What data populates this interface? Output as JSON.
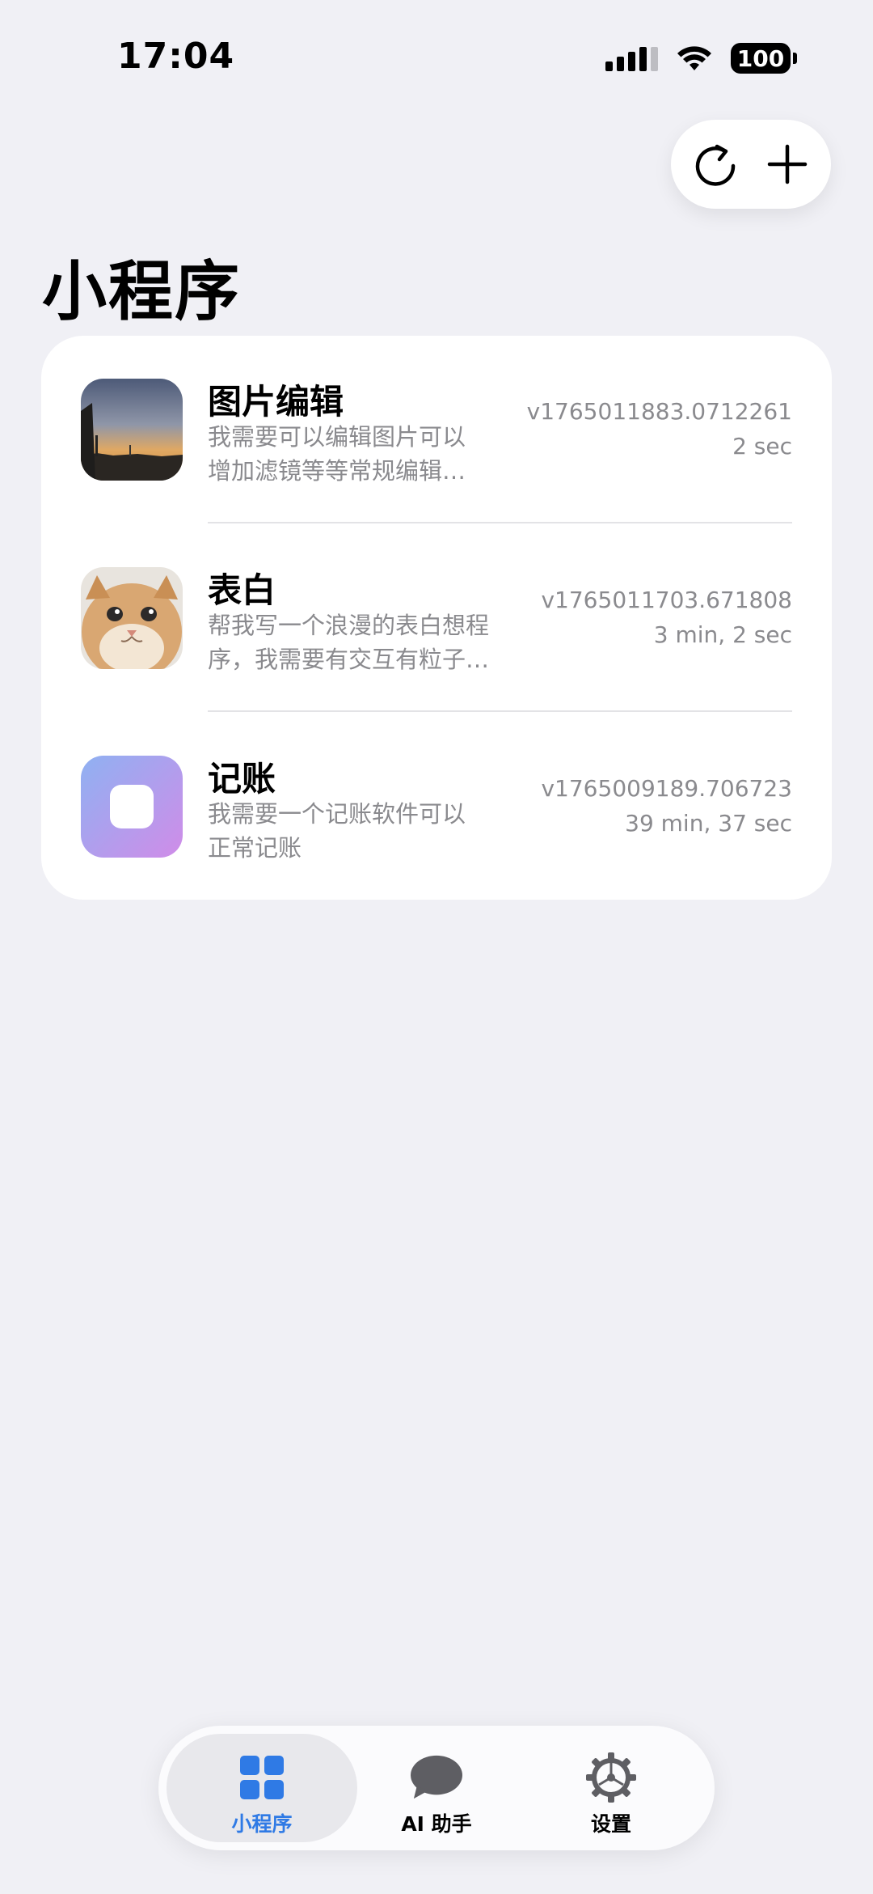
{
  "status_bar": {
    "time": "17:04",
    "battery": "100"
  },
  "top_actions": {
    "refresh_icon": "refresh-icon",
    "add_icon": "plus-icon"
  },
  "page": {
    "title": "小程序"
  },
  "apps": [
    {
      "name": "图片编辑",
      "desc_line1": "我需要可以编辑图片可以",
      "desc_line2": "增加滤镜等等常规编辑…",
      "version": "v1765011883.0712261",
      "elapsed": "2 sec",
      "thumb": "sunset-photo"
    },
    {
      "name": "表白",
      "desc_line1": "帮我写一个浪漫的表白想程",
      "desc_line2": "序，我需要有交互有粒子…",
      "version": "v1765011703.671808",
      "elapsed": "3 min, 2 sec",
      "thumb": "cat-photo"
    },
    {
      "name": "记账",
      "desc_line1": "我需要一个记账软件可以",
      "desc_line2": "正常记账",
      "version": "v1765009189.706723",
      "elapsed": "39 min, 37 sec",
      "thumb": "gradient-app-icon"
    }
  ],
  "tabbar": {
    "tabs": [
      {
        "label": "小程序",
        "icon": "grid-icon",
        "active": true
      },
      {
        "label": "AI 助手",
        "icon": "chat-bubble-icon",
        "active": false
      },
      {
        "label": "设置",
        "icon": "gear-icon",
        "active": false
      }
    ]
  },
  "colors": {
    "background": "#f0f0f5",
    "accent": "#2f7ae5",
    "secondary_text": "#8a8a8e"
  }
}
